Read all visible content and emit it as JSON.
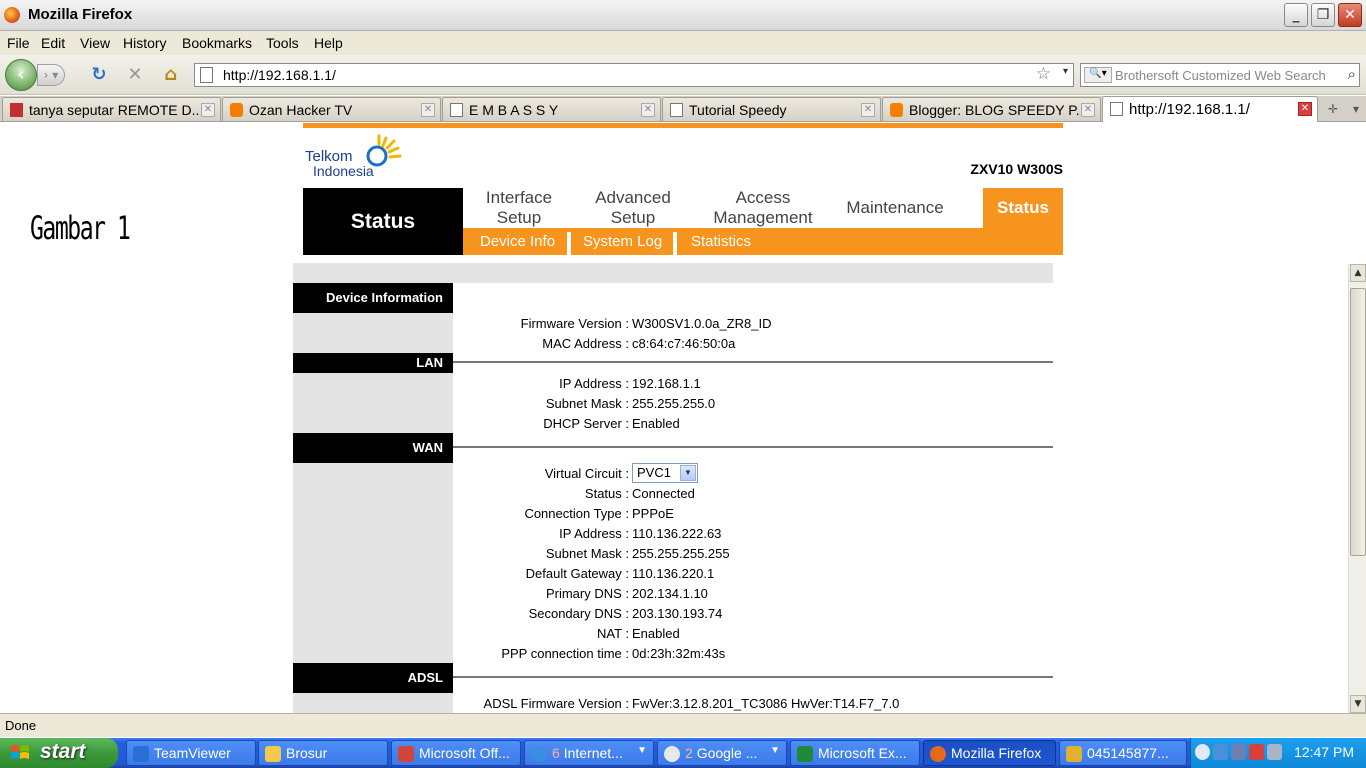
{
  "window": {
    "title": "Mozilla Firefox",
    "buttons": {
      "minimize": "_",
      "restore": "❐",
      "close": "✕"
    }
  },
  "menubar": [
    "File",
    "Edit",
    "View",
    "History",
    "Bookmarks",
    "Tools",
    "Help"
  ],
  "navbar": {
    "url": "http://192.168.1.1/",
    "search_placeholder": "Brothersoft Customized Web Search"
  },
  "tabs": [
    {
      "label": "tanya seputar REMOTE D...",
      "icon": "wb-favicon",
      "color": "#c23030",
      "active": false
    },
    {
      "label": "Ozan Hacker TV",
      "icon": "blogger-favicon",
      "color": "#f57d00",
      "active": false
    },
    {
      "label": "E M B A S S Y",
      "icon": "page-favicon",
      "color": "#ffffff",
      "active": false
    },
    {
      "label": "Tutorial Speedy",
      "icon": "page-favicon",
      "color": "#ffffff",
      "active": false
    },
    {
      "label": "Blogger: BLOG SPEEDY P...",
      "icon": "blogger-favicon",
      "color": "#f57d00",
      "active": false
    },
    {
      "label": "http://192.168.1.1/",
      "icon": "page-favicon",
      "color": "#ffffff",
      "active": true
    }
  ],
  "page": {
    "annotation": "Gambar 1",
    "logo": {
      "line1": "Telkom",
      "line2": "Indonesia"
    },
    "model": "ZXV10 W300S",
    "status_block": "Status",
    "main_menu": [
      {
        "label": "Interface\nSetup",
        "active": false
      },
      {
        "label": "Advanced\nSetup",
        "active": false
      },
      {
        "label": "Access\nManagement",
        "active": false
      },
      {
        "label": "Maintenance",
        "active": false
      },
      {
        "label": "Status",
        "active": true
      }
    ],
    "sub_menu": [
      "Device Info",
      "System Log",
      "Statistics"
    ],
    "sections": {
      "device": {
        "title": "Device Information",
        "rows": [
          {
            "label": "Firmware Version :",
            "value": "W300SV1.0.0a_ZR8_ID"
          },
          {
            "label": "MAC Address :",
            "value": "c8:64:c7:46:50:0a"
          }
        ]
      },
      "lan": {
        "title": "LAN",
        "rows": [
          {
            "label": "IP Address :",
            "value": "192.168.1.1"
          },
          {
            "label": "Subnet Mask :",
            "value": "255.255.255.0"
          },
          {
            "label": "DHCP Server :",
            "value": "Enabled"
          }
        ]
      },
      "wan": {
        "title": "WAN",
        "virtual_circuit_label": "Virtual Circuit :",
        "virtual_circuit_value": "PVC1",
        "rows": [
          {
            "label": "Status :",
            "value": "Connected"
          },
          {
            "label": "Connection Type :",
            "value": "PPPoE"
          },
          {
            "label": "IP Address :",
            "value": "110.136.222.63"
          },
          {
            "label": "Subnet Mask :",
            "value": "255.255.255.255"
          },
          {
            "label": "Default Gateway :",
            "value": "110.136.220.1"
          },
          {
            "label": "Primary DNS :",
            "value": "202.134.1.10"
          },
          {
            "label": "Secondary DNS :",
            "value": "203.130.193.74"
          },
          {
            "label": "NAT :",
            "value": "Enabled"
          },
          {
            "label": "PPP connection time :",
            "value": "0d:23h:32m:43s"
          }
        ]
      },
      "adsl": {
        "title": "ADSL",
        "rows": [
          {
            "label": "ADSL Firmware Version :",
            "value": "FwVer:3.12.8.201_TC3086 HwVer:T14.F7_7.0"
          }
        ]
      }
    }
  },
  "statusbar": {
    "text": "Done"
  },
  "taskbar": {
    "start": "start",
    "items": [
      {
        "label": "TeamViewer",
        "num": "",
        "icon_color": "#2a6fd6",
        "caret": false,
        "active": false
      },
      {
        "label": "Brosur",
        "num": "",
        "icon_color": "#f2c94c",
        "caret": false,
        "active": false
      },
      {
        "label": "Microsoft Off...",
        "num": "",
        "icon_color": "#d0463a",
        "caret": false,
        "active": false
      },
      {
        "label": "Internet...",
        "num": "6",
        "icon_color": "#3b8de0",
        "caret": true,
        "active": false
      },
      {
        "label": "Google ...",
        "num": "2",
        "icon_color": "#e8e8e8",
        "caret": true,
        "active": false
      },
      {
        "label": "Microsoft Ex...",
        "num": "",
        "icon_color": "#1e8a3a",
        "caret": false,
        "active": false
      },
      {
        "label": "Mozilla Firefox",
        "num": "",
        "icon_color": "#e8681a",
        "caret": false,
        "active": true
      },
      {
        "label": "045145877...",
        "num": "",
        "icon_color": "#e0b030",
        "caret": false,
        "active": false
      }
    ],
    "clock": "12:47 PM"
  }
}
